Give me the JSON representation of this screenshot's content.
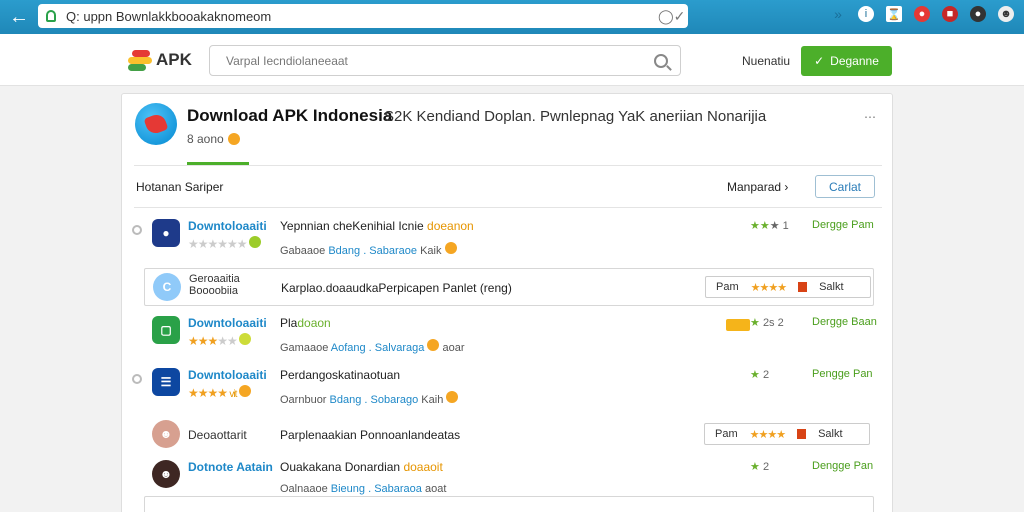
{
  "browser": {
    "url": "Q: uppn Bownlakkbooakaknomeom"
  },
  "header": {
    "logo_text": "APK",
    "search_placeholder": "Varpal Iecndiolaneeaat",
    "link": "Nuenatiu",
    "button": "Deganne"
  },
  "app": {
    "title": "Download APK Indonesia",
    "subtitle": "S2K Kendiand Doplan. Pwnlepnag YaK aneriian Nonarijia",
    "meta": "8 aono"
  },
  "section": {
    "title": "Hotanan Sariper",
    "link": "Manparad",
    "button": "Carlat"
  },
  "rows": [
    {
      "name": "Downtoloaaiti",
      "desc": "Yepnnian cheKenihial Icnie",
      "desc_hl": "doeanon",
      "cat_a": "Gabaaoe",
      "cat_link": "Bdang . Sabaraoe",
      "cat_b": "Kaik",
      "rating_text": "1",
      "download": "Dergge Pam"
    },
    {
      "name": "Geroaaitia",
      "name2": "Boooobiia",
      "desc": "Karplao.doaaudkaPerpicapen Panlet (reng)",
      "pill_label": "Pam",
      "pill_action": "Salkt"
    },
    {
      "name": "Downtoloaaiti",
      "desc": "Pla",
      "desc_hl": "doaon",
      "cat_a": "Gamaaoe",
      "cat_link": "Aofang . Salvaraga",
      "cat_b": "aoar",
      "rating_text": "2s 2",
      "download": "Dergge Baan"
    },
    {
      "name": "Downtoloaaiti",
      "desc": "Perdangoskatinaotuan",
      "cat_a": "Oarnbuor",
      "cat_link": "Bdang . Sobarago",
      "cat_b": "Kaih",
      "stars_tail": "vit",
      "rating_text": "2",
      "download": "Pengge Pan"
    },
    {
      "name": "Deoaottarit",
      "desc": "Parplenaakian Ponnoanlandeatas",
      "pill_label": "Pam",
      "pill_action": "Salkt"
    },
    {
      "name": "Dotnote Aatain",
      "desc": "Ouakakana Donardian",
      "desc_hl": "doaaoit",
      "cat_a": "Oalnaaoe",
      "cat_link": "Bieung . Sabaraoa",
      "cat_b": "aoat",
      "rating_text": "2",
      "download": "Dengge Pan"
    }
  ]
}
